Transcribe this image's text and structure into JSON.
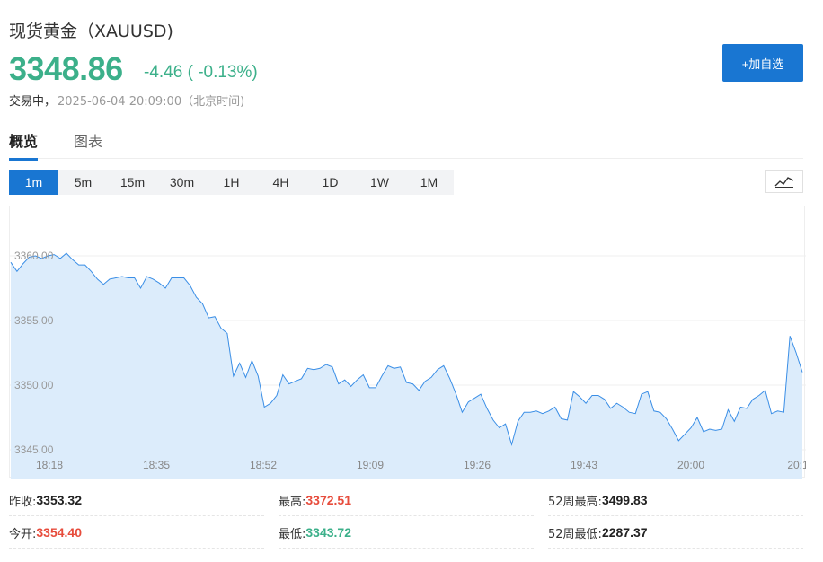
{
  "header": {
    "title": "现货黄金（XAUUSD)",
    "price": "3348.86",
    "change": "-4.46 ( -0.13%)",
    "status": "交易中，",
    "time": "2025-06-04 20:09:00（北京时间)",
    "add_button": "+加自选"
  },
  "tabs": [
    {
      "label": "概览",
      "active": true
    },
    {
      "label": "图表",
      "active": false
    }
  ],
  "intervals": [
    {
      "label": "1m",
      "active": true
    },
    {
      "label": "5m"
    },
    {
      "label": "15m"
    },
    {
      "label": "30m"
    },
    {
      "label": "1H"
    },
    {
      "label": "4H"
    },
    {
      "label": "1D"
    },
    {
      "label": "1W"
    },
    {
      "label": "1M"
    }
  ],
  "icons": {
    "chart_type": "line-chart-icon"
  },
  "colors": {
    "accent": "#1976d2",
    "up": "#e74c3c",
    "down": "#3cb08a",
    "line": "#3a8ee6",
    "area": "#dcecfb"
  },
  "chart_data": {
    "type": "area",
    "ylim": [
      3344,
      3363
    ],
    "yticks": [
      "3345.00",
      "3350.00",
      "3355.00",
      "3360.00"
    ],
    "xticks": [
      "18:18",
      "18:35",
      "18:52",
      "19:09",
      "19:26",
      "19:43",
      "20:00",
      "20:1"
    ],
    "series": [
      {
        "values": [
          3359.5,
          3358.8,
          3359.4,
          3359.9,
          3360.0,
          3359.8,
          3360.0,
          3360.1,
          3359.8,
          3360.2,
          3359.7,
          3359.3,
          3359.3,
          3358.8,
          3358.2,
          3357.8,
          3358.2,
          3358.3,
          3358.4,
          3358.3,
          3358.3,
          3357.5,
          3358.4,
          3358.2,
          3357.9,
          3357.5,
          3358.3,
          3358.3,
          3358.3,
          3357.7,
          3356.8,
          3356.3,
          3355.2,
          3355.3,
          3354.4,
          3354.0,
          3350.7,
          3351.7,
          3350.6,
          3351.9,
          3350.7,
          3348.3,
          3348.6,
          3349.2,
          3350.8,
          3350.1,
          3350.3,
          3350.5,
          3351.3,
          3351.2,
          3351.3,
          3351.6,
          3351.4,
          3350.1,
          3350.4,
          3349.9,
          3350.4,
          3350.8,
          3349.8,
          3349.8,
          3350.7,
          3351.5,
          3351.3,
          3351.4,
          3350.2,
          3350.1,
          3349.6,
          3350.3,
          3350.6,
          3351.2,
          3351.5,
          3350.5,
          3349.3,
          3347.9,
          3348.7,
          3349.0,
          3349.3,
          3348.2,
          3347.3,
          3346.7,
          3347.0,
          3345.4,
          3347.2,
          3347.9,
          3347.9,
          3348.0,
          3347.8,
          3348.0,
          3348.3,
          3347.4,
          3347.3,
          3349.5,
          3349.1,
          3348.6,
          3349.2,
          3349.2,
          3348.9,
          3348.2,
          3348.6,
          3348.3,
          3347.9,
          3347.8,
          3349.3,
          3349.5,
          3348.0,
          3347.9,
          3347.4,
          3346.6,
          3345.7,
          3346.2,
          3346.7,
          3347.5,
          3346.4,
          3346.6,
          3346.5,
          3346.6,
          3348.1,
          3347.2,
          3348.3,
          3348.2,
          3348.9,
          3349.2,
          3349.6,
          3347.8,
          3348.0,
          3347.9,
          3353.8,
          3352.5,
          3351.0
        ]
      }
    ]
  },
  "stats": [
    {
      "label": "昨收:",
      "value": "3353.32",
      "tone": "neutral"
    },
    {
      "label": "最高:",
      "value": "3372.51",
      "tone": "red"
    },
    {
      "label": "52周最高:",
      "value": "3499.83",
      "tone": "neutral"
    },
    {
      "label": "今开:",
      "value": "3354.40",
      "tone": "red"
    },
    {
      "label": "最低:",
      "value": "3343.72",
      "tone": "green"
    },
    {
      "label": "52周最低:",
      "value": "2287.37",
      "tone": "neutral"
    }
  ]
}
